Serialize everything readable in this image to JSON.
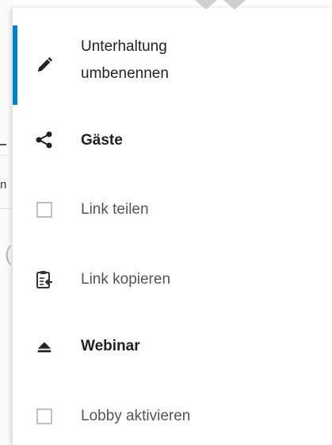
{
  "menu": {
    "items": [
      {
        "icon": "pencil-icon",
        "label_line1": "Unterhaltung",
        "label_line2": "umbenennen"
      },
      {
        "icon": "share-icon",
        "label": "Gäste"
      },
      {
        "icon": "checkbox-icon",
        "label": "Link teilen"
      },
      {
        "icon": "clipboard-icon",
        "label": "Link kopieren"
      },
      {
        "icon": "eject-icon",
        "label": "Webinar"
      },
      {
        "icon": "checkbox-icon",
        "label": "Lobby aktivieren"
      }
    ]
  },
  "background": {
    "peek_letter": "n"
  },
  "colors": {
    "accent": "#0082c9"
  }
}
